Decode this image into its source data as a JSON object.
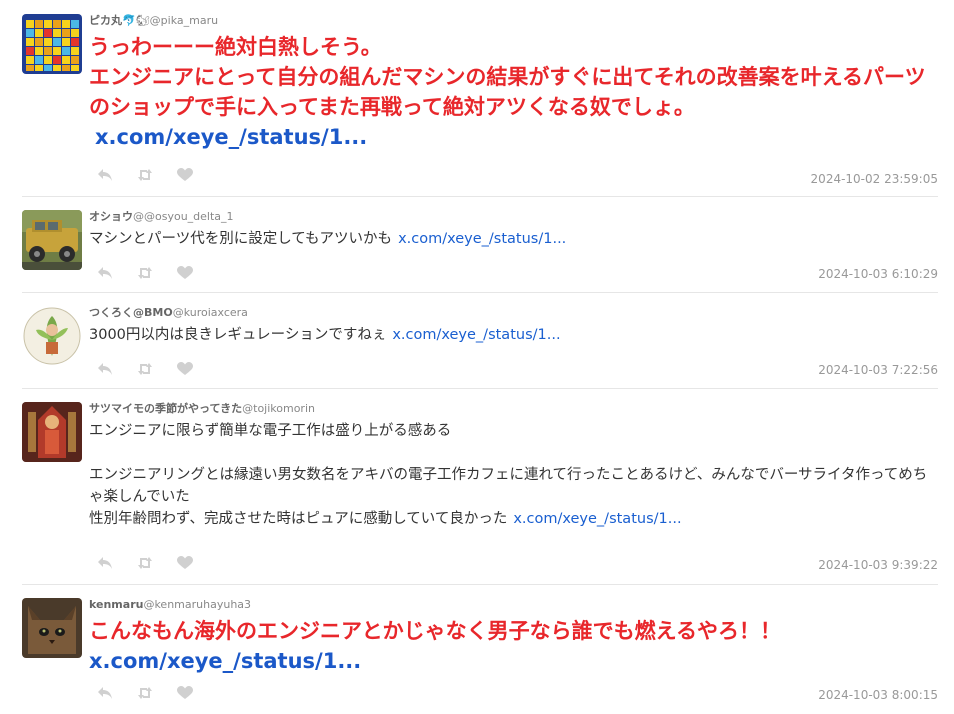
{
  "tweets": [
    {
      "display_name": "ピカ丸",
      "emoji": "🐬🐿",
      "handle": "@pika_maru",
      "text": [
        "うっわーーー絶対白熱しそう。",
        "エンジニアにとって自分の組んだマシンの結果がすぐに出てそれの改善案を叶えるパーツのショップで手に入ってまた再戦って絶対アツくなる奴でしょ。"
      ],
      "link": "x.com/xeye_/status/1...",
      "timestamp": "2024-10-02 23:59:05"
    },
    {
      "display_name": "オショウ",
      "handle": "@@osyou_delta_1",
      "text": [
        "マシンとパーツ代を別に設定してもアツいかも"
      ],
      "link": "x.com/xeye_/status/1...",
      "timestamp": "2024-10-03 6:10:29"
    },
    {
      "display_name": "つくろく@BMO",
      "handle": "@kuroiaxcera",
      "text": [
        "3000円以内は良きレギュレーションですねぇ"
      ],
      "link": "x.com/xeye_/status/1...",
      "timestamp": "2024-10-03 7:22:56"
    },
    {
      "display_name": "サツマイモの季節がやってきた",
      "handle": "@tojikomorin",
      "text": [
        "エンジニアに限らず簡単な電子工作は盛り上がる感ある",
        "",
        "エンジニアリングとは縁遠い男女数名をアキバの電子工作カフェに連れて行ったことあるけど、みんなでバーサライタ作ってめちゃ楽しんでいた",
        "性別年齢問わず、完成させた時はピュアに感動していて良かった"
      ],
      "link": "x.com/xeye_/status/1...",
      "timestamp": "2024-10-03 9:39:22"
    },
    {
      "display_name": "kenmaru",
      "handle": "@kenmaruhayuha3",
      "text": [
        "こんなもん海外のエンジニアとかじゃなく男子なら誰でも燃えるやろ！！"
      ],
      "link": "x.com/xeye_/status/1...",
      "timestamp": "2024-10-03 8:00:15"
    }
  ],
  "icons": [
    "reply-icon",
    "retweet-icon",
    "like-icon"
  ],
  "colors": {
    "highlight_text": "#e8272b",
    "link": "#1a5fd0",
    "meta_text": "#999999",
    "divider": "#e6e6e6",
    "action_icon": "#d0d0d0"
  }
}
